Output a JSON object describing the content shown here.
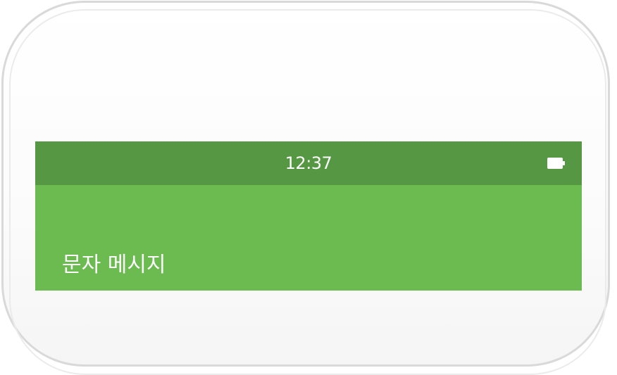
{
  "status_bar": {
    "time": "12:37",
    "battery_icon": "battery-full-icon",
    "color": "#559742"
  },
  "app_bar": {
    "title": "문자 메시지",
    "color": "#6bbb50"
  }
}
